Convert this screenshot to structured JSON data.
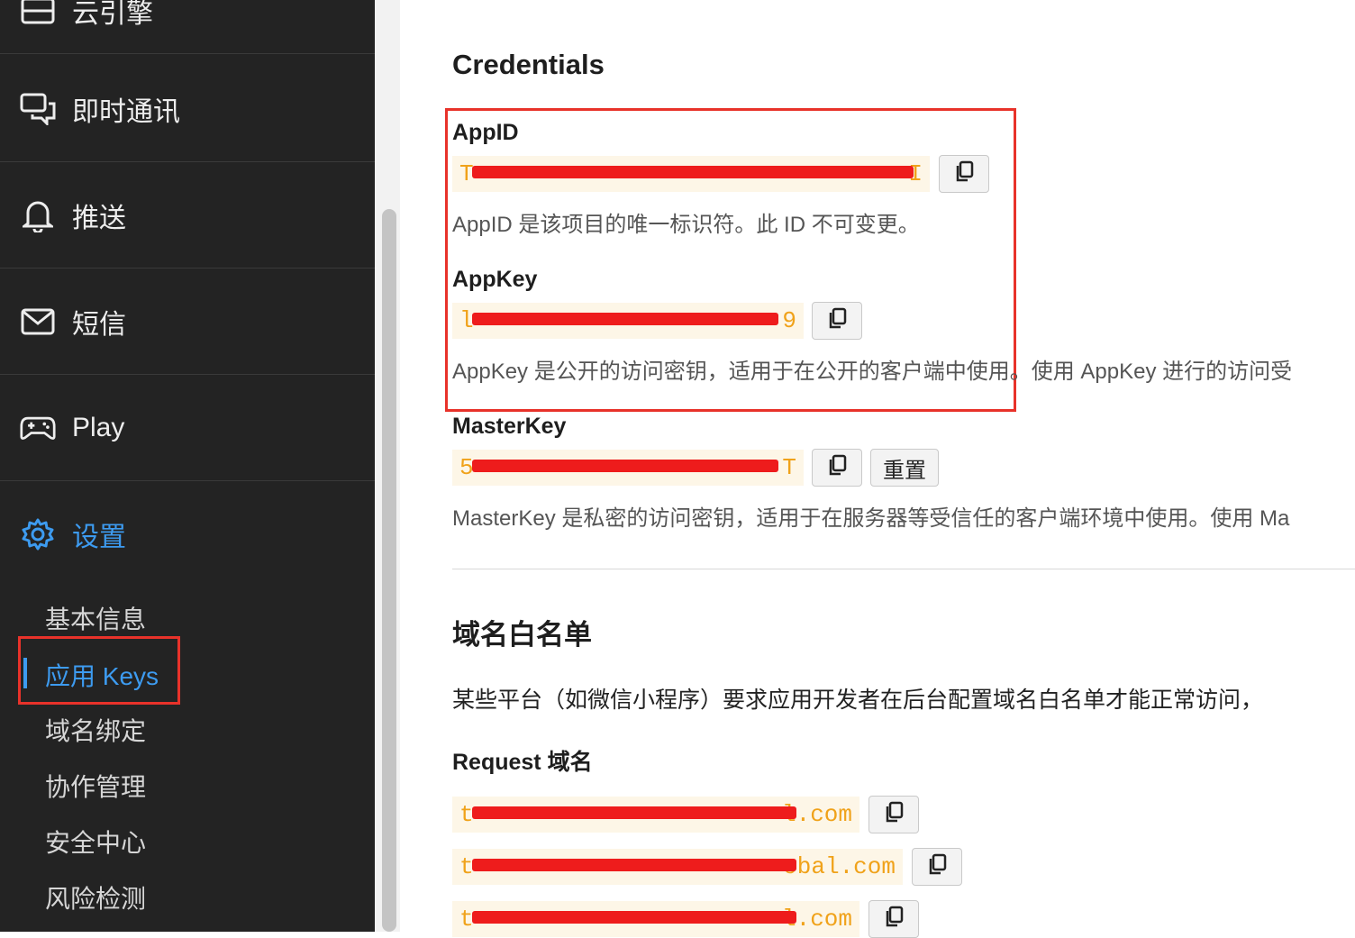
{
  "sidebar": {
    "top_partial_label": "云引擎",
    "items": [
      {
        "label": "即时通讯",
        "icon": "chat-bubbles-icon"
      },
      {
        "label": "推送",
        "icon": "bell-icon"
      },
      {
        "label": "短信",
        "icon": "envelope-icon"
      },
      {
        "label": "Play",
        "icon": "gamepad-icon"
      },
      {
        "label": "设置",
        "icon": "gear-icon",
        "active": true
      }
    ],
    "sub_items": [
      {
        "label": "基本信息"
      },
      {
        "label": "应用 Keys",
        "active": true
      },
      {
        "label": "域名绑定"
      },
      {
        "label": "协作管理"
      },
      {
        "label": "安全中心"
      },
      {
        "label": "风险检测"
      }
    ]
  },
  "credentials": {
    "title": "Credentials",
    "appid": {
      "label": "AppID",
      "value": "T",
      "value_tail": "I",
      "description": "AppID 是该项目的唯一标识符。此 ID 不可变更。"
    },
    "appkey": {
      "label": "AppKey",
      "value": "l",
      "value_tail": "9",
      "description": "AppKey 是公开的访问密钥，适用于在公开的客户端中使用。使用 AppKey 进行的访问受"
    },
    "masterkey": {
      "label": "MasterKey",
      "value": "5",
      "value_tail": "T",
      "reset_label": "重置",
      "description": "MasterKey 是私密的访问密钥，适用于在服务器等受信任的客户端环境中使用。使用 Ma"
    }
  },
  "whitelist": {
    "title": "域名白名单",
    "description": "某些平台（如微信小程序）要求应用开发者在后台配置域名白名单才能正常访问，",
    "request_label": "Request 域名",
    "domains": [
      {
        "prefix": "t",
        "suffix": "l.com"
      },
      {
        "prefix": "t",
        "suffix": "obal.com"
      },
      {
        "prefix": "t",
        "suffix": "l.com"
      }
    ]
  },
  "colors": {
    "sidebar_bg": "#232323",
    "accent": "#3d9bf0",
    "code_text": "#f0a21a",
    "code_bg": "#fdf6e7",
    "highlight": "#e8322a"
  }
}
